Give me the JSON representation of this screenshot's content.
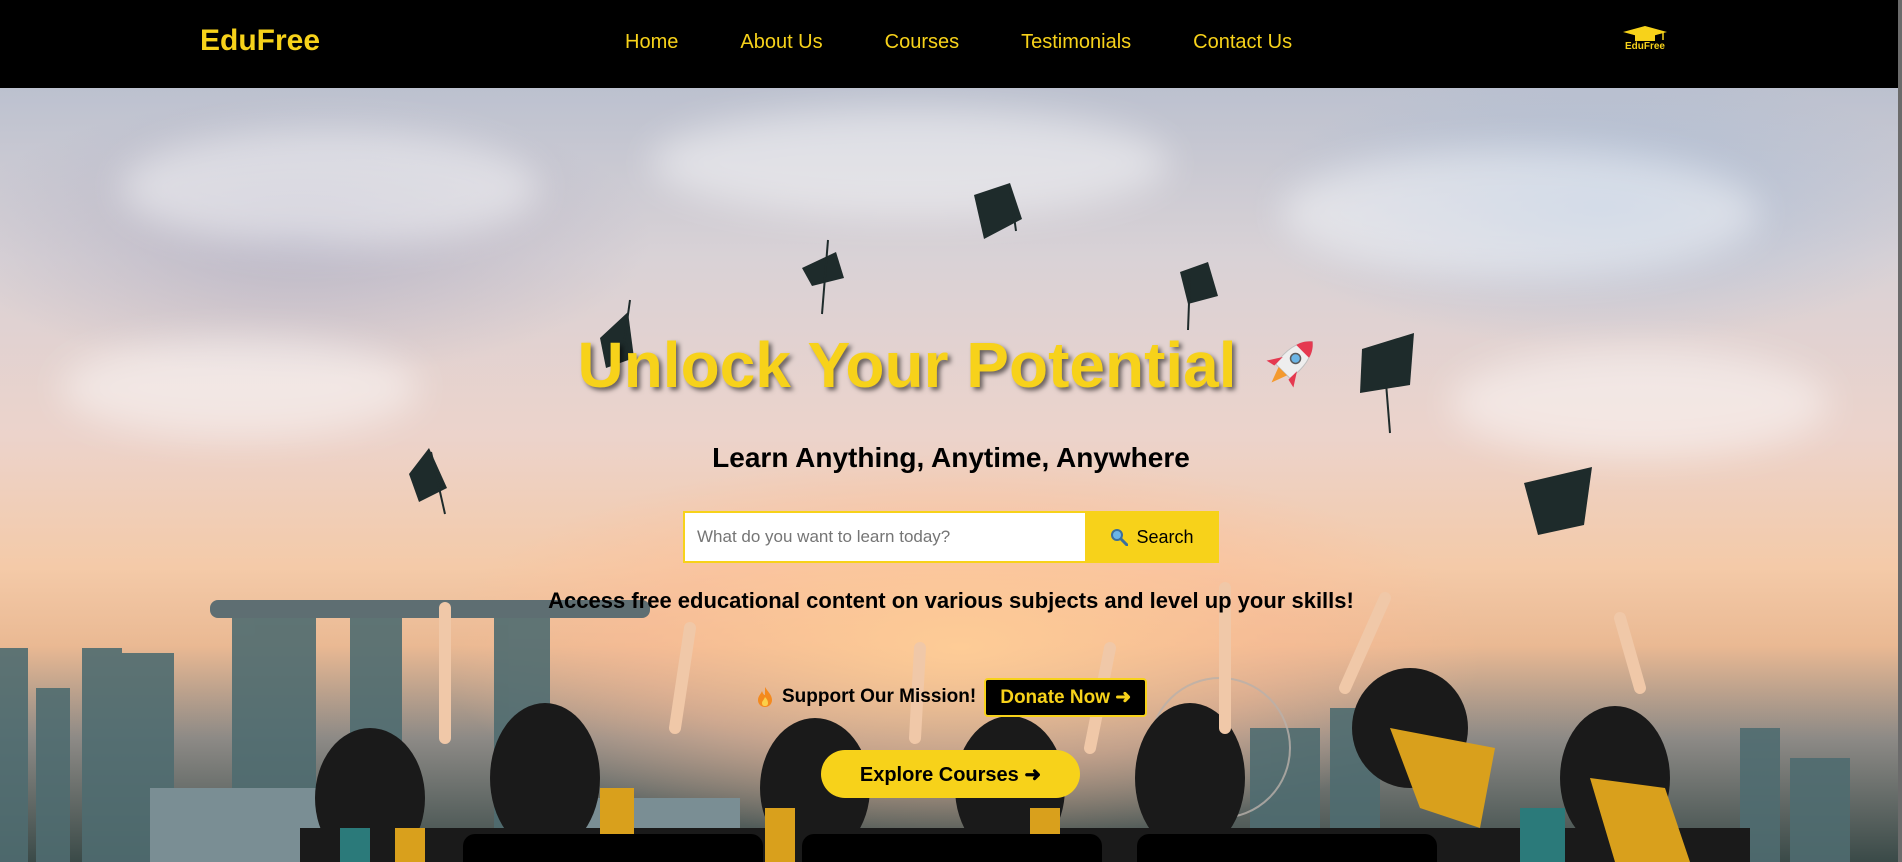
{
  "navbar": {
    "brand": "EduFree",
    "links": [
      "Home",
      "About Us",
      "Courses",
      "Testimonials",
      "Contact Us"
    ],
    "logo_text": "EduFree",
    "logo_icon": "graduation-cap-icon"
  },
  "hero": {
    "title": "Unlock Your Potential",
    "title_icon": "rocket-icon",
    "subtitle": "Learn Anything, Anytime, Anywhere",
    "search": {
      "placeholder": "What do you want to learn today?",
      "value": "",
      "button_label": "Search",
      "button_icon": "magnifying-glass-icon"
    },
    "description": "Access free educational content on various subjects and level up your skills!",
    "support": {
      "icon": "flame-icon",
      "text": "Support Our Mission!",
      "donate_label": "Donate Now ➜"
    },
    "explore_label": "Explore Courses ➜"
  },
  "colors": {
    "accent": "#f7d21a",
    "navbar_bg": "#000000",
    "text_dark": "#000000"
  }
}
